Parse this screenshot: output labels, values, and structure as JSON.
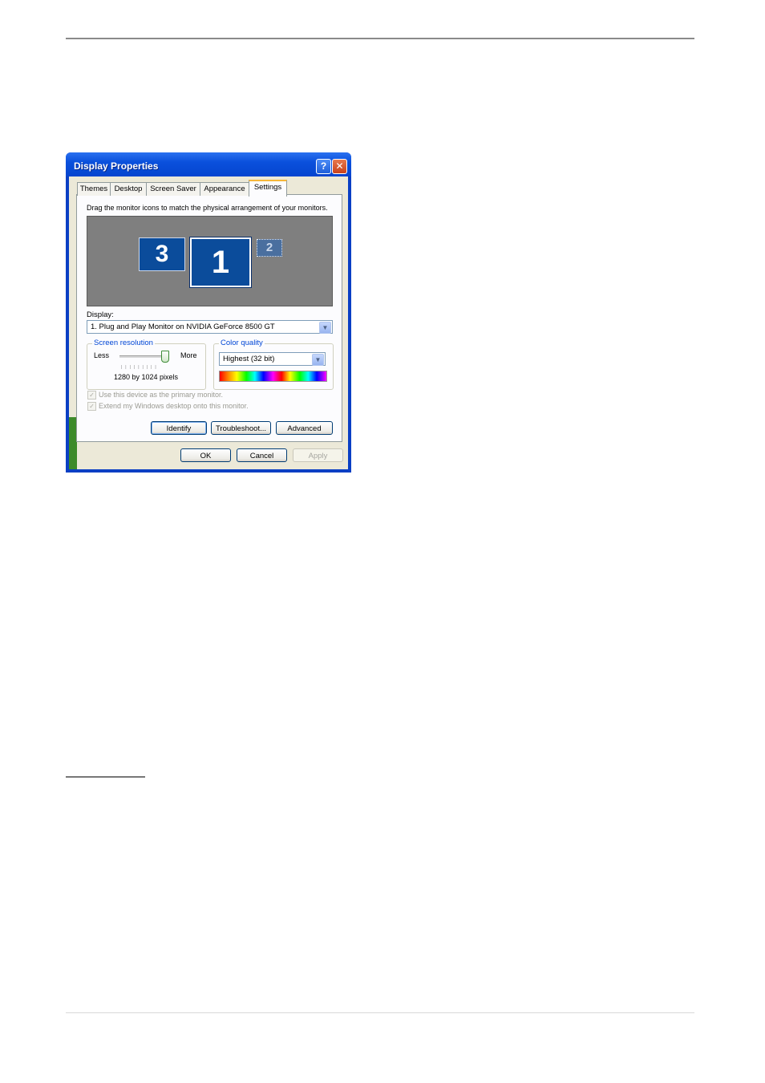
{
  "window": {
    "title": "Display Properties",
    "help_button": "?",
    "close_button": "✕"
  },
  "tabs": [
    "Themes",
    "Desktop",
    "Screen Saver",
    "Appearance",
    "Settings"
  ],
  "active_tab": "Settings",
  "settings": {
    "instruction": "Drag the monitor icons to match the physical arrangement of your monitors.",
    "monitors": [
      "3",
      "1",
      "2"
    ],
    "display_label": "Display:",
    "display_value": "1. Plug and Play Monitor on NVIDIA GeForce 8500 GT",
    "screen_resolution": {
      "title": "Screen resolution",
      "less": "Less",
      "more": "More",
      "value_text": "1280 by 1024 pixels"
    },
    "color_quality": {
      "title": "Color quality",
      "value": "Highest (32 bit)"
    },
    "checkbox_primary": "Use this device as the primary monitor.",
    "checkbox_extend": "Extend my Windows desktop onto this monitor.",
    "buttons": {
      "identify": "Identify",
      "troubleshoot": "Troubleshoot...",
      "advanced": "Advanced"
    }
  },
  "dialog_buttons": {
    "ok": "OK",
    "cancel": "Cancel",
    "apply": "Apply"
  }
}
